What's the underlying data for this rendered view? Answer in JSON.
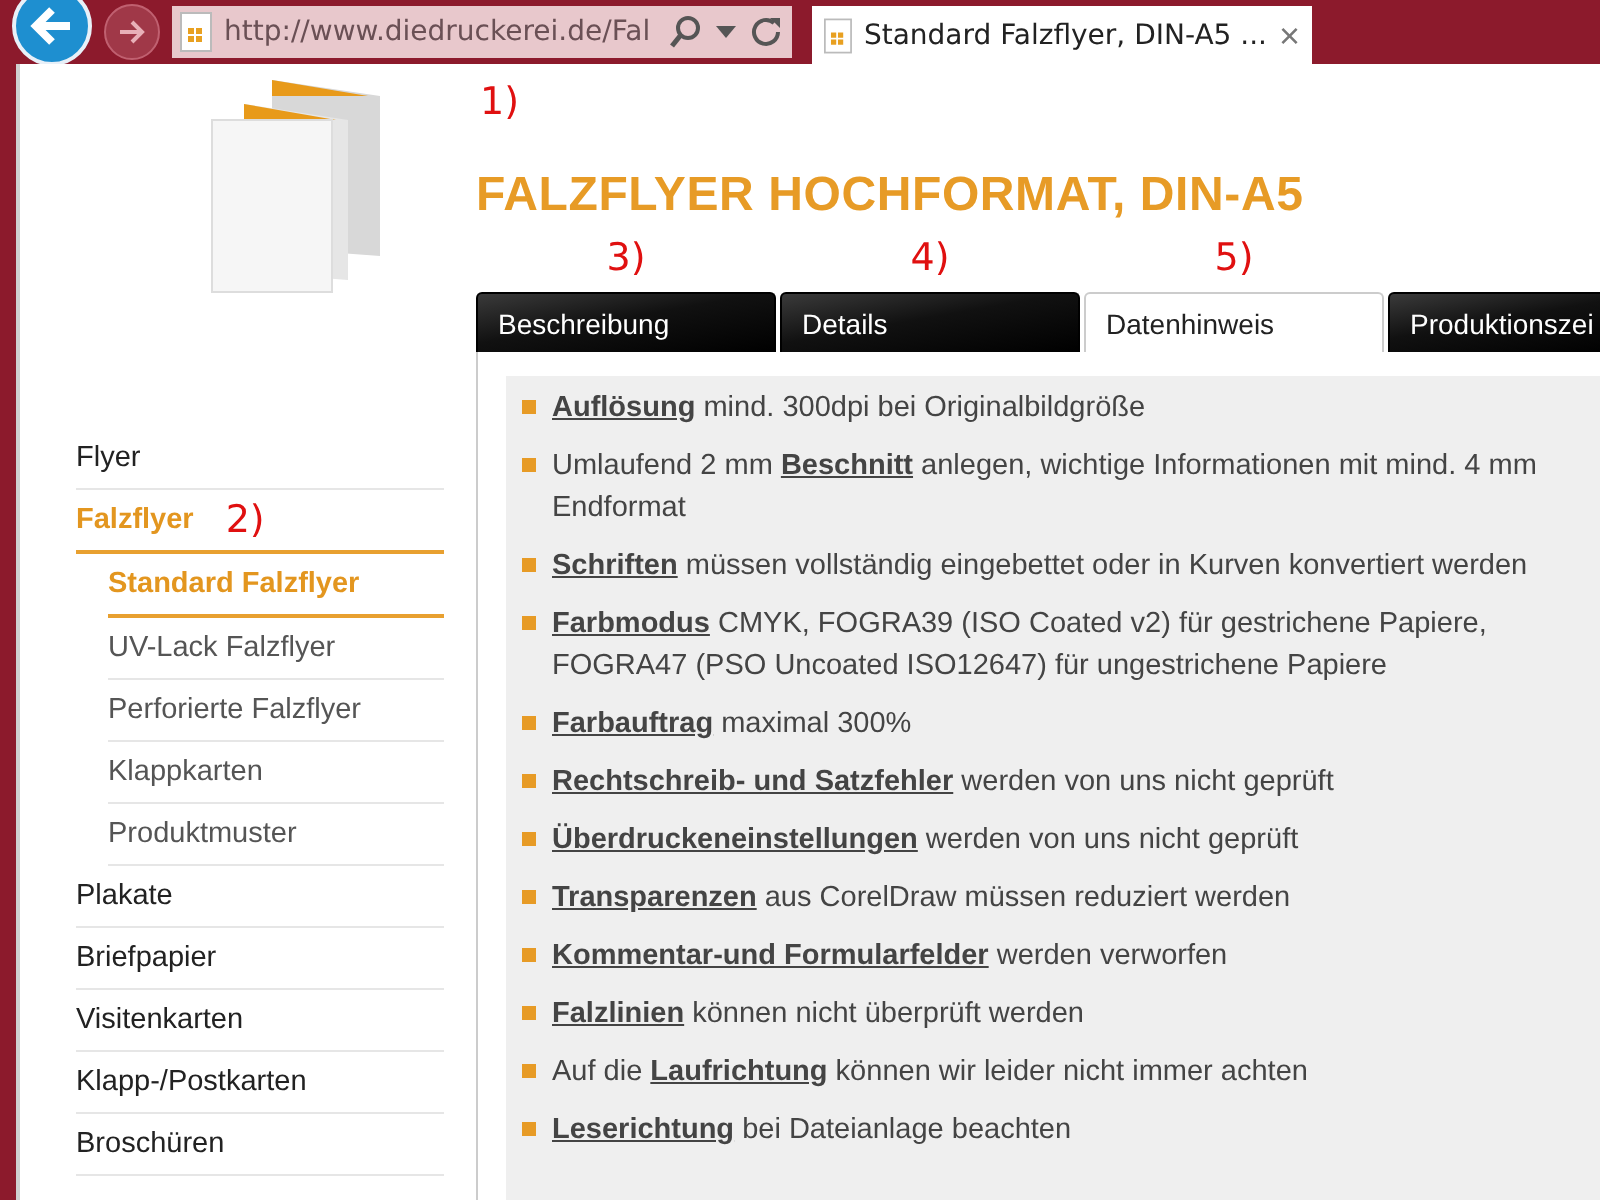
{
  "browser": {
    "url": "http://www.diedruckerei.de/Fal",
    "tab_title": "Standard Falzflyer, DIN-A5 ...",
    "close": "×"
  },
  "annotation_top": "1)",
  "title": "FALZFLYER HOCHFORMAT, DIN-A5",
  "tabs": [
    {
      "label": "Beschreibung",
      "selected": false,
      "annotation": "3)"
    },
    {
      "label": "Details",
      "selected": false,
      "annotation": "4)"
    },
    {
      "label": "Datenhinweis",
      "selected": true,
      "annotation": "5)"
    },
    {
      "label": "Produktionszei",
      "selected": false
    }
  ],
  "sidebar": {
    "items": [
      {
        "label": "Flyer",
        "selected": false
      },
      {
        "label": "Falzflyer",
        "selected": true,
        "annotation": "2)",
        "children": [
          {
            "label": "Standard Falzflyer",
            "selected": true
          },
          {
            "label": "UV-Lack Falzflyer",
            "selected": false
          },
          {
            "label": "Perforierte Falzflyer",
            "selected": false
          },
          {
            "label": "Klappkarten",
            "selected": false
          },
          {
            "label": "Produktmuster",
            "selected": false
          }
        ]
      },
      {
        "label": "Plakate",
        "selected": false
      },
      {
        "label": "Briefpapier",
        "selected": false
      },
      {
        "label": "Visitenkarten",
        "selected": false
      },
      {
        "label": "Klapp-/Postkarten",
        "selected": false
      },
      {
        "label": "Broschüren",
        "selected": false
      }
    ]
  },
  "hints": [
    "**Auflösung** mind. 300dpi bei Originalbildgröße",
    "Umlaufend 2 mm **Beschnitt** anlegen, wichtige Informationen mit mind. 4 mm Endformat",
    "**Schriften** müssen vollständig eingebettet oder in Kurven konvertiert werden",
    "**Farbmodus** CMYK, FOGRA39 (ISO Coated v2) für gestrichene Papiere, FOGRA47 (PSO Uncoated ISO12647) für ungestrichene Papiere",
    "**Farbauftrag** maximal 300%",
    "**Rechtschreib- und Satzfehler** werden von uns nicht geprüft",
    "**Überdruckeneinstellungen** werden von uns nicht geprüft",
    "**Transparenzen** aus CorelDraw müssen reduziert werden",
    "**Kommentar-und Formularfelder** werden verworfen",
    "**Falzlinien** können nicht überprüft werden",
    "Auf die **Laufrichtung** können wir leider nicht immer achten",
    "**Leserichtung** bei Dateianlage beachten"
  ]
}
